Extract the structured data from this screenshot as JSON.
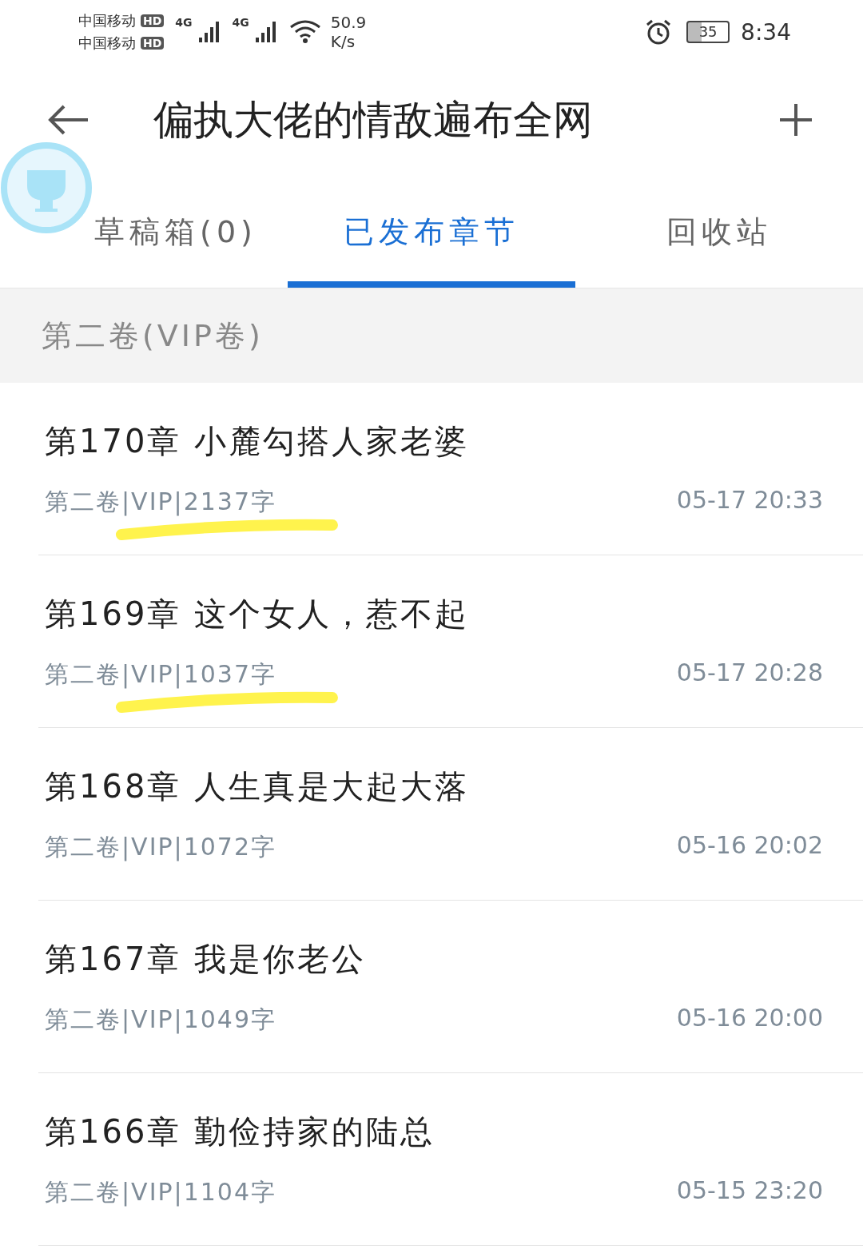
{
  "status_bar": {
    "carriers": [
      "中国移动",
      "中国移动"
    ],
    "hd_badges": [
      "HD",
      "HD"
    ],
    "network_labels": [
      "4G",
      "4G"
    ],
    "speed": [
      "50.9",
      "K/s"
    ],
    "battery": "35",
    "time": "8:34"
  },
  "header": {
    "title": "偏执大佬的情敌遍布全网"
  },
  "tabs": [
    {
      "label": "草稿箱(0)",
      "selected": false
    },
    {
      "label": "已发布章节",
      "selected": true
    },
    {
      "label": "回收站",
      "selected": false
    }
  ],
  "section": {
    "title": "第二卷(VIP卷)"
  },
  "chapters": [
    {
      "title": "第170章 小麓勾搭人家老婆",
      "meta": "第二卷|VIP|2137字",
      "date": "05-17 20:33",
      "highlighted": true
    },
    {
      "title": "第169章 这个女人，惹不起",
      "meta": "第二卷|VIP|1037字",
      "date": "05-17 20:28",
      "highlighted": true
    },
    {
      "title": "第168章 人生真是大起大落",
      "meta": "第二卷|VIP|1072字",
      "date": "05-16 20:02",
      "highlighted": false
    },
    {
      "title": "第167章 我是你老公",
      "meta": "第二卷|VIP|1049字",
      "date": "05-16 20:00",
      "highlighted": false
    },
    {
      "title": "第166章 勤俭持家的陆总",
      "meta": "第二卷|VIP|1104字",
      "date": "05-15 23:20",
      "highlighted": false
    }
  ]
}
